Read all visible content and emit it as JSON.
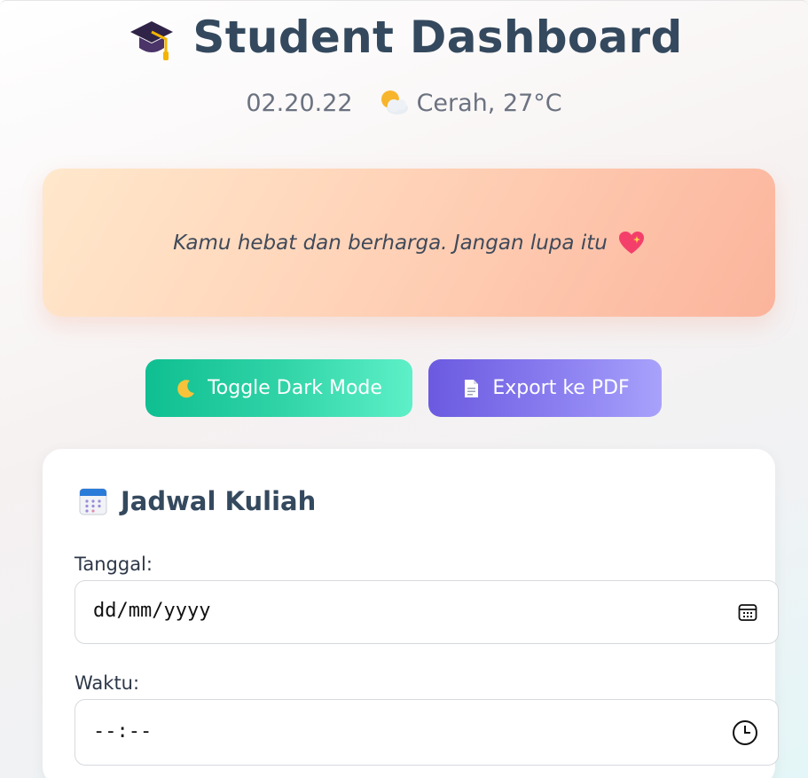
{
  "header": {
    "title": "Student Dashboard",
    "date": "02.20.22",
    "weather": "Cerah, 27°C",
    "cap_icon": "graduation-cap-icon",
    "weather_icon": "sun-behind-cloud-icon"
  },
  "quote": {
    "text": "Kamu hebat dan berharga. Jangan lupa itu",
    "icon": "sparkling-heart-icon"
  },
  "actions": {
    "dark_mode_label": "Toggle Dark Mode",
    "dark_mode_icon": "crescent-moon-icon",
    "export_label": "Export ke PDF",
    "export_icon": "document-icon"
  },
  "schedule": {
    "title": "Jadwal Kuliah",
    "icon": "calendar-icon",
    "date_label": "Tanggal:",
    "date_placeholder": "dd/mm/yyyy",
    "time_label": "Waktu:",
    "time_placeholder": "--:--"
  },
  "colors": {
    "title": "#34495e",
    "dark_mode_button": "#1cc99a",
    "export_button": "#7c6cea",
    "quote_card": "#ffd3b8"
  }
}
